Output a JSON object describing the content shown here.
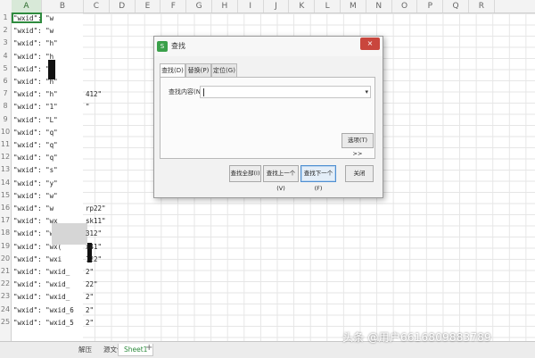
{
  "column_headers": [
    "A",
    "B",
    "C",
    "D",
    "E",
    "F",
    "G",
    "H",
    "I",
    "J",
    "K",
    "L",
    "M",
    "N",
    "O",
    "P",
    "Q",
    "R"
  ],
  "row_numbers": [
    "1",
    "2",
    "3",
    "4",
    "5",
    "6",
    "7",
    "8",
    "9",
    "10",
    "11",
    "12",
    "13",
    "14",
    "15",
    "16",
    "17",
    "18",
    "19",
    "20",
    "21",
    "22",
    "23",
    "24",
    "25"
  ],
  "column_a": [
    "\"wxid\": \"w",
    "\"wxid\": \"w",
    "\"wxid\": \"h\"",
    "\"wxid\": \"h",
    "\"wxid\": \"d",
    "\"wxid\": \"h\"",
    "\"wxid\": \"h\"",
    "\"wxid\": \"1\"",
    "\"wxid\": \"L\"",
    "\"wxid\": \"q\"",
    "\"wxid\": \"q\"",
    "\"wxid\": \"q\"",
    "\"wxid\": \"s\"",
    "\"wxid\": \"y\"",
    "\"wxid\": \"w\"",
    "\"wxid\": \"w",
    "\"wxid\": \"wx",
    "\"wxid\": \"wx",
    "\"wxid\": \"wx(",
    "\"wxid\": \"wxi",
    "\"wxid\": \"wxid_",
    "\"wxid\": \"wxid_",
    "\"wxid\": \"wxid_",
    "\"wxid\": \"wxid_6",
    "\"wxid\": \"wxid_5"
  ],
  "column_c": [
    {
      "row": 7,
      "text": "412\""
    },
    {
      "row": 8,
      "text": "\""
    },
    {
      "row": 16,
      "text": "rp22\""
    },
    {
      "row": 17,
      "text": "sk11\""
    },
    {
      "row": 18,
      "text": "312\""
    },
    {
      "row": 19,
      "text": "x41\""
    },
    {
      "row": 20,
      "text": "122\""
    },
    {
      "row": 21,
      "text": "2\""
    },
    {
      "row": 22,
      "text": "22\""
    },
    {
      "row": 23,
      "text": "2\""
    },
    {
      "row": 24,
      "text": "2\""
    },
    {
      "row": 25,
      "text": "2\""
    }
  ],
  "sheet_tabs": {
    "tab1": "解压",
    "tab2": "源文件",
    "active": "Sheet1",
    "add": "+"
  },
  "dialog": {
    "icon_text": "S",
    "title": "查找",
    "close": "×",
    "tabs": [
      "查找(D)",
      "替换(P)",
      "定位(G)"
    ],
    "find_label": "查找内容(N):",
    "find_value": "",
    "dropdown_arrow": "▾",
    "options_button": "选项(T) >>",
    "buttons": {
      "find_all": "查找全部(I)",
      "find_prev": "查找上一个(V)",
      "find_next": "查找下一个(F)",
      "close": "关闭"
    }
  },
  "watermark": "头条 @用户6616809883789",
  "colors": {
    "accent": "#2e8b3e",
    "close": "#c9463d",
    "primary_border": "#4f8fd1"
  }
}
